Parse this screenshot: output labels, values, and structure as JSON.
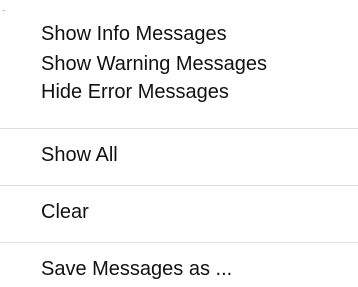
{
  "menu": {
    "items": [
      {
        "label": "Show Info Messages"
      },
      {
        "label": "Show Warning Messages"
      },
      {
        "label": "Hide Error Messages"
      },
      {
        "label": "Show All"
      },
      {
        "label": "Clear"
      },
      {
        "label": "Save Messages as ..."
      }
    ]
  }
}
